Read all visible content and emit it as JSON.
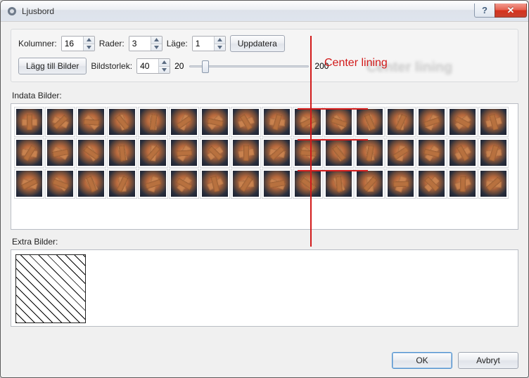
{
  "window": {
    "title": "Ljusbord"
  },
  "controls": {
    "columns_label": "Kolumner:",
    "columns_value": "16",
    "rows_label": "Rader:",
    "rows_value": "3",
    "mode_label": "Läge:",
    "mode_value": "1",
    "update_label": "Uppdatera",
    "add_images_label": "Lägg till Bilder",
    "image_size_label": "Bildstorlek:",
    "image_size_value": "40",
    "slider_min_label": "20",
    "slider_max_label": "200",
    "slider_value": 40
  },
  "sections": {
    "input_images_label": "Indata Bilder:",
    "extra_images_label": "Extra Bilder:"
  },
  "thumbs": {
    "cols": 16,
    "rows": 3
  },
  "annotation": {
    "label": "Center lining",
    "shadow": "Center lining"
  },
  "buttons": {
    "ok": "OK",
    "cancel": "Avbryt"
  }
}
